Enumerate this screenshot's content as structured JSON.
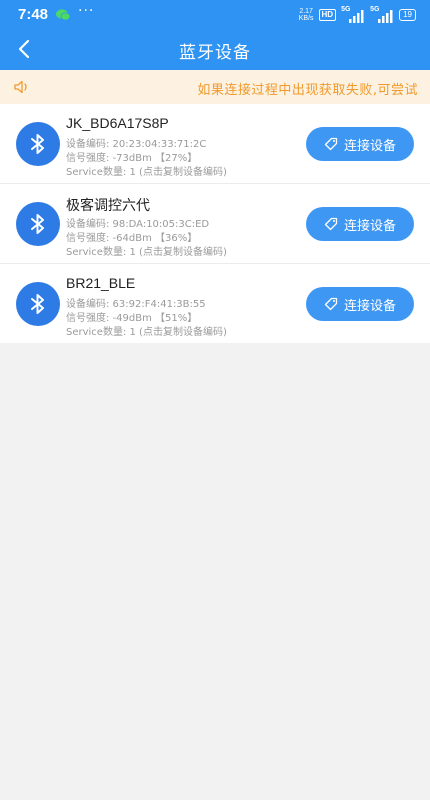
{
  "status_bar": {
    "time": "7:48",
    "net_speed_value": "2.17",
    "net_speed_unit": "KB/s",
    "hd": "HD",
    "sig1": "5G",
    "sig2": "5G",
    "battery": "19",
    "dots": "···"
  },
  "header": {
    "title": "蓝牙设备"
  },
  "notice": {
    "text": "如果连接过程中出现获取失败,可尝试"
  },
  "devices": [
    {
      "name": "JK_BD6A17S8P",
      "code": "设备编码: 20:23:04:33:71:2C",
      "signal": "信号强度: -73dBm 【27%】",
      "service": "Service数量: 1 (点击复制设备编码)",
      "button": "连接设备"
    },
    {
      "name": "极客调控六代",
      "code": "设备编码: 98:DA:10:05:3C:ED",
      "signal": "信号强度: -64dBm 【36%】",
      "service": "Service数量: 1 (点击复制设备编码)",
      "button": "连接设备"
    },
    {
      "name": "BR21_BLE",
      "code": "设备编码: 63:92:F4:41:3B:55",
      "signal": "信号强度: -49dBm 【51%】",
      "service": "Service数量: 1 (点击复制设备编码)",
      "button": "连接设备"
    }
  ],
  "icons": {
    "back": "chevron-left-icon",
    "notice": "speaker-icon",
    "device": "bluetooth-icon",
    "button": "tag-icon"
  },
  "colors": {
    "header": "#2e93f2",
    "notice_bg": "#fdf2e2",
    "notice_text": "#f09a2c",
    "button": "#3d97f3",
    "bluetooth": "#2e7be5"
  }
}
